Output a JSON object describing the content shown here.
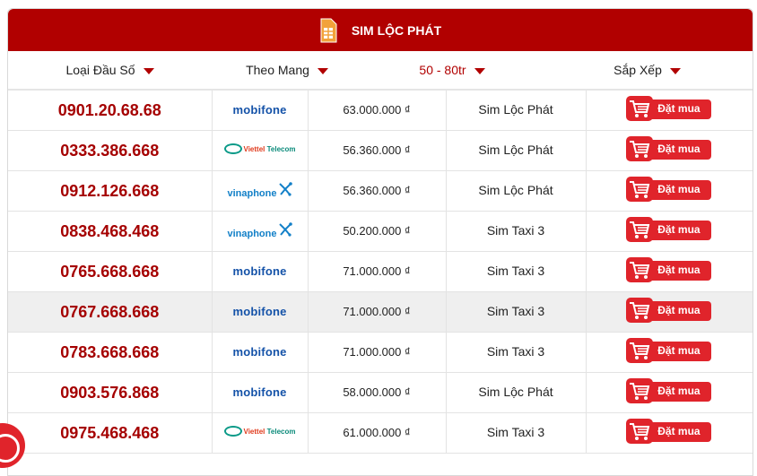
{
  "header": {
    "title": "SIM LỘC PHÁT"
  },
  "filters": [
    {
      "label": "Loại Đầu Số",
      "active": false
    },
    {
      "label": "Theo Mang",
      "active": false
    },
    {
      "label": "50 - 80tr",
      "active": true
    },
    {
      "label": "Sắp Xếp",
      "active": false
    }
  ],
  "carriers": {
    "mobifone": "mobifone",
    "viettel": {
      "word": "Viettel",
      "suffix": "Telecom"
    },
    "vinaphone": "vinaphone"
  },
  "buy_label": "Đặt mua",
  "rows": [
    {
      "number": "0901.20.68.68",
      "carrier": "mobifone",
      "price": "63.000.000 ₫",
      "category": "Sim Lộc Phát",
      "highlighted": false
    },
    {
      "number": "0333.386.668",
      "carrier": "viettel",
      "price": "56.360.000 ₫",
      "category": "Sim Lộc Phát",
      "highlighted": false
    },
    {
      "number": "0912.126.668",
      "carrier": "vinaphone",
      "price": "56.360.000 ₫",
      "category": "Sim Lộc Phát",
      "highlighted": false
    },
    {
      "number": "0838.468.468",
      "carrier": "vinaphone",
      "price": "50.200.000 ₫",
      "category": "Sim Taxi 3",
      "highlighted": false
    },
    {
      "number": "0765.668.668",
      "carrier": "mobifone",
      "price": "71.000.000 ₫",
      "category": "Sim Taxi 3",
      "highlighted": false
    },
    {
      "number": "0767.668.668",
      "carrier": "mobifone",
      "price": "71.000.000 ₫",
      "category": "Sim Taxi 3",
      "highlighted": true
    },
    {
      "number": "0783.668.668",
      "carrier": "mobifone",
      "price": "71.000.000 ₫",
      "category": "Sim Taxi 3",
      "highlighted": false
    },
    {
      "number": "0903.576.868",
      "carrier": "mobifone",
      "price": "58.000.000 ₫",
      "category": "Sim Lộc Phát",
      "highlighted": false
    },
    {
      "number": "0975.468.468",
      "carrier": "viettel",
      "price": "61.000.000 ₫",
      "category": "Sim Taxi 3",
      "highlighted": false
    }
  ],
  "colors": {
    "brand": "#b10000",
    "number": "#a50000",
    "buy": "#e0242b",
    "highlight_row": "#efefef"
  }
}
